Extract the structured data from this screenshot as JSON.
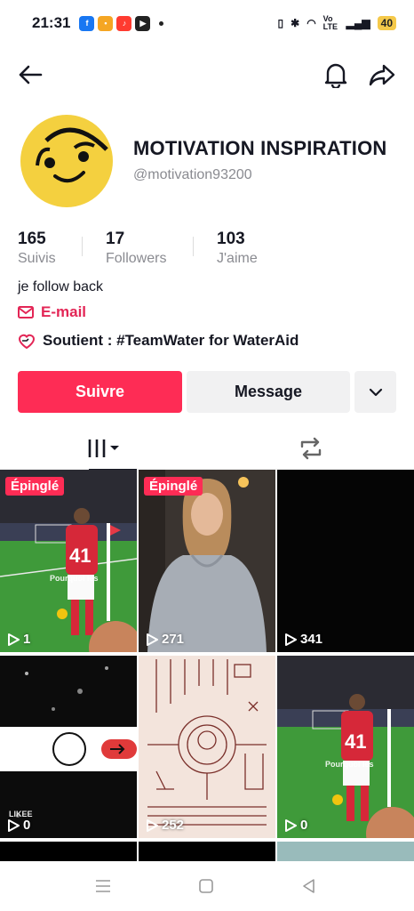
{
  "status_bar": {
    "time": "21:31",
    "battery": "40",
    "network": "Vo LTE"
  },
  "profile": {
    "display_name": "MOTIVATION INSPIRATION",
    "handle": "@motivation93200",
    "stats": [
      {
        "value": "165",
        "label": "Suivis"
      },
      {
        "value": "17",
        "label": "Followers"
      },
      {
        "value": "103",
        "label": "J'aime"
      }
    ],
    "bio": "je follow back",
    "email_label": "E-mail",
    "support_text": "Soutient : #TeamWater for WaterAid"
  },
  "actions": {
    "follow": "Suivre",
    "message": "Message"
  },
  "videos": [
    {
      "pinned": "Épinglé",
      "views": "1",
      "overlay": "Pourquoi les",
      "theme": "stadium"
    },
    {
      "pinned": "Épinglé",
      "views": "271",
      "theme": "hoodie"
    },
    {
      "views": "341",
      "theme": "black"
    },
    {
      "views": "0",
      "theme": "toggle",
      "watermark": "LIKEE"
    },
    {
      "views": "252",
      "theme": "sketch"
    },
    {
      "views": "0",
      "overlay": "Pourquoi les",
      "theme": "stadium"
    }
  ],
  "colors": {
    "accent": "#fe2c55",
    "email": "#e32656"
  }
}
